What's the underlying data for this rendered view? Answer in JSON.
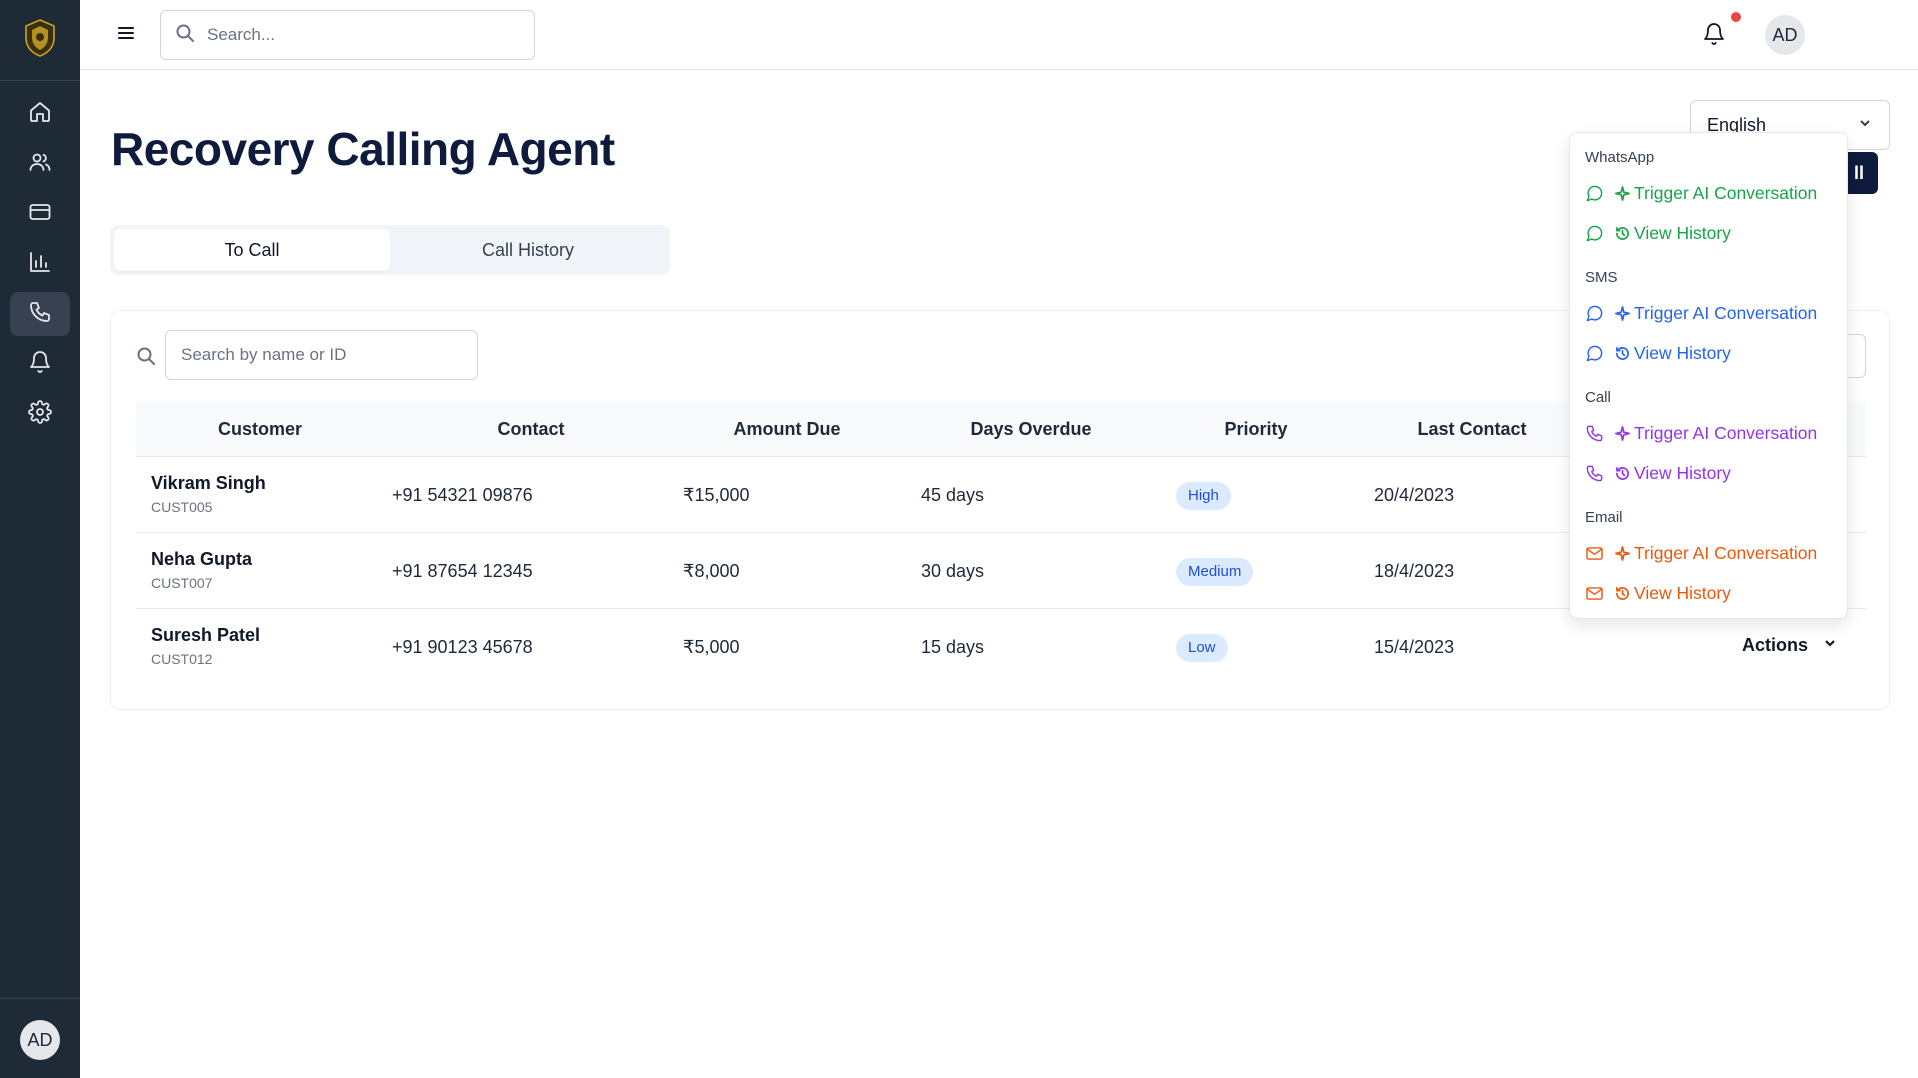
{
  "sidebar": {
    "logo": "shield-crest-logo",
    "items": [
      {
        "icon": "home-icon"
      },
      {
        "icon": "users-icon"
      },
      {
        "icon": "credit-card-icon"
      },
      {
        "icon": "bar-chart-icon"
      },
      {
        "icon": "phone-icon",
        "active": true
      },
      {
        "icon": "bell-icon"
      },
      {
        "icon": "gear-icon"
      }
    ],
    "avatar_initials": "AD"
  },
  "topbar": {
    "search_placeholder": "Search...",
    "avatar_initials": "AD",
    "notification_dot_color": "#ef4444"
  },
  "page": {
    "title": "Recovery Calling Agent",
    "language": "English",
    "dark_button_fragment": "ll"
  },
  "tabs": [
    {
      "label": "To Call",
      "active": true
    },
    {
      "label": "Call History",
      "active": false
    }
  ],
  "table": {
    "search_placeholder": "Search by name or ID",
    "columns": [
      "Customer",
      "Contact",
      "Amount Due",
      "Days Overdue",
      "Priority",
      "Last Contact"
    ],
    "rows": [
      {
        "name": "Vikram Singh",
        "id": "CUST005",
        "contact": "+91 54321 09876",
        "amount": "₹15,000",
        "days": "45 days",
        "priority": "High",
        "last_contact": "20/4/2023"
      },
      {
        "name": "Neha Gupta",
        "id": "CUST007",
        "contact": "+91 87654 12345",
        "amount": "₹8,000",
        "days": "30 days",
        "priority": "Medium",
        "last_contact": "18/4/2023"
      },
      {
        "name": "Suresh Patel",
        "id": "CUST012",
        "contact": "+91 90123 45678",
        "amount": "₹5,000",
        "days": "15 days",
        "priority": "Low",
        "last_contact": "15/4/2023",
        "actions_label": "Actions"
      }
    ]
  },
  "dropdown": {
    "sections": [
      {
        "title": "WhatsApp",
        "color": "#16a34a",
        "icon": "message-circle-icon",
        "trigger": "Trigger AI Conversation",
        "history": "View History"
      },
      {
        "title": "SMS",
        "color": "#2563eb",
        "icon": "message-circle-icon",
        "trigger": "Trigger AI Conversation",
        "history": "View History"
      },
      {
        "title": "Call",
        "color": "#9333ea",
        "icon": "phone-icon",
        "trigger": "Trigger AI Conversation",
        "history": "View History"
      },
      {
        "title": "Email",
        "color": "#ea580c",
        "icon": "mail-icon",
        "trigger": "Trigger AI Conversation",
        "history": "View History"
      }
    ]
  }
}
